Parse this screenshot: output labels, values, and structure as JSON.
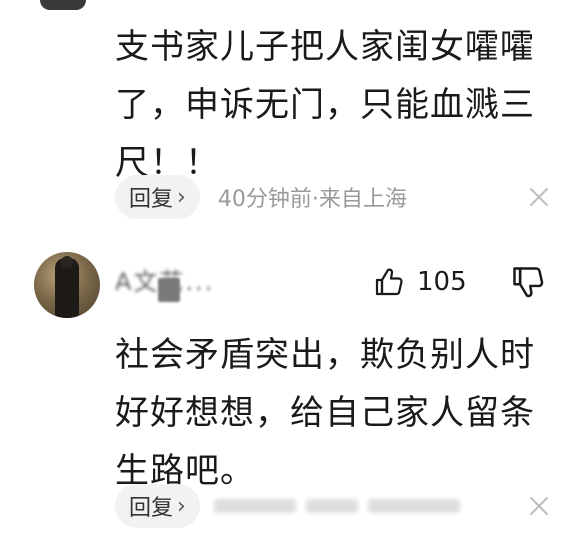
{
  "comment1": {
    "text": "支书家儿子把人家闺女嚯嚯\n了，申诉无门，只能血溅三\n尺！！",
    "reply_label": "回复",
    "reply_chevron": "›",
    "meta": "40分钟前·来自上海"
  },
  "comment2": {
    "username": "A文艺...",
    "like_count": "105",
    "text": "社会矛盾突出，欺负别人时\n好好想想，给自己家人留条\n生路吧。",
    "reply_label": "回复",
    "reply_chevron": "›"
  },
  "icons": {
    "like": "thumbs-up-icon",
    "dislike": "thumbs-down-icon",
    "close": "close-icon",
    "chevron": "chevron-right-icon"
  },
  "colors": {
    "text": "#1a1a1a",
    "meta": "#9a9a9a",
    "pill_bg": "#f2f2f2",
    "close": "#bdbdbd"
  }
}
